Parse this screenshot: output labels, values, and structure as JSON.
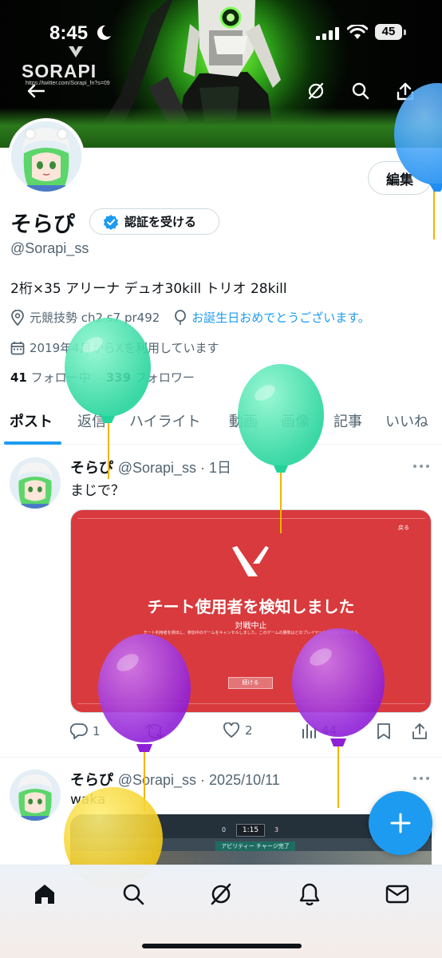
{
  "status_bar": {
    "time": "8:45",
    "battery": "45"
  },
  "banner": {
    "brand": "SORAPI",
    "url": "https://twitter.com/Sorapi_fn?s=09"
  },
  "profile": {
    "edit_label": "編集",
    "display_name": "そらぴ",
    "verify_label": "認証を受ける",
    "handle": "@Sorapi_ss",
    "bio": "2桁×35 アリーナ デュオ30kill トリオ 28kill",
    "category": "元競技勢 ch2 s7 pr492",
    "birthday_link": "お誕生日おめでとうございます。",
    "joined": "2019年4月からXを利用しています",
    "following_count": "41",
    "following_label": "フォロー中",
    "followers_count": "339",
    "followers_label": "フォロワー"
  },
  "tabs": [
    {
      "label": "ポスト"
    },
    {
      "label": "返信"
    },
    {
      "label": "ハイライト"
    },
    {
      "label": "動画"
    },
    {
      "label": "画像"
    },
    {
      "label": "記事"
    },
    {
      "label": "いいね"
    }
  ],
  "posts": [
    {
      "name": "そらぴ",
      "meta": "@Sorapi_ss · 1日",
      "text": "まじで？",
      "media": {
        "title": "チート使用者を検知しました",
        "subtitle": "対戦中止",
        "detail": "チート利用者を検出し、参加中のゲームをキャンセルしました。このゲームの勝敗はどのプレイヤーにも記録されません",
        "button": "続ける",
        "back": "戻る"
      },
      "replies": "1",
      "likes": "2",
      "views": "44"
    },
    {
      "name": "そらぴ",
      "meta": "@Sorapi_ss · 2025/10/11",
      "text": "waka",
      "media": {
        "round": "1:15",
        "score_left": "0",
        "score_right": "3",
        "banner": "アビリティー チャージ完了"
      }
    }
  ],
  "colors": {
    "accent": "#1d9bf0",
    "text": "#0f1419",
    "muted": "#536471",
    "media_red": "#d93a3d"
  }
}
